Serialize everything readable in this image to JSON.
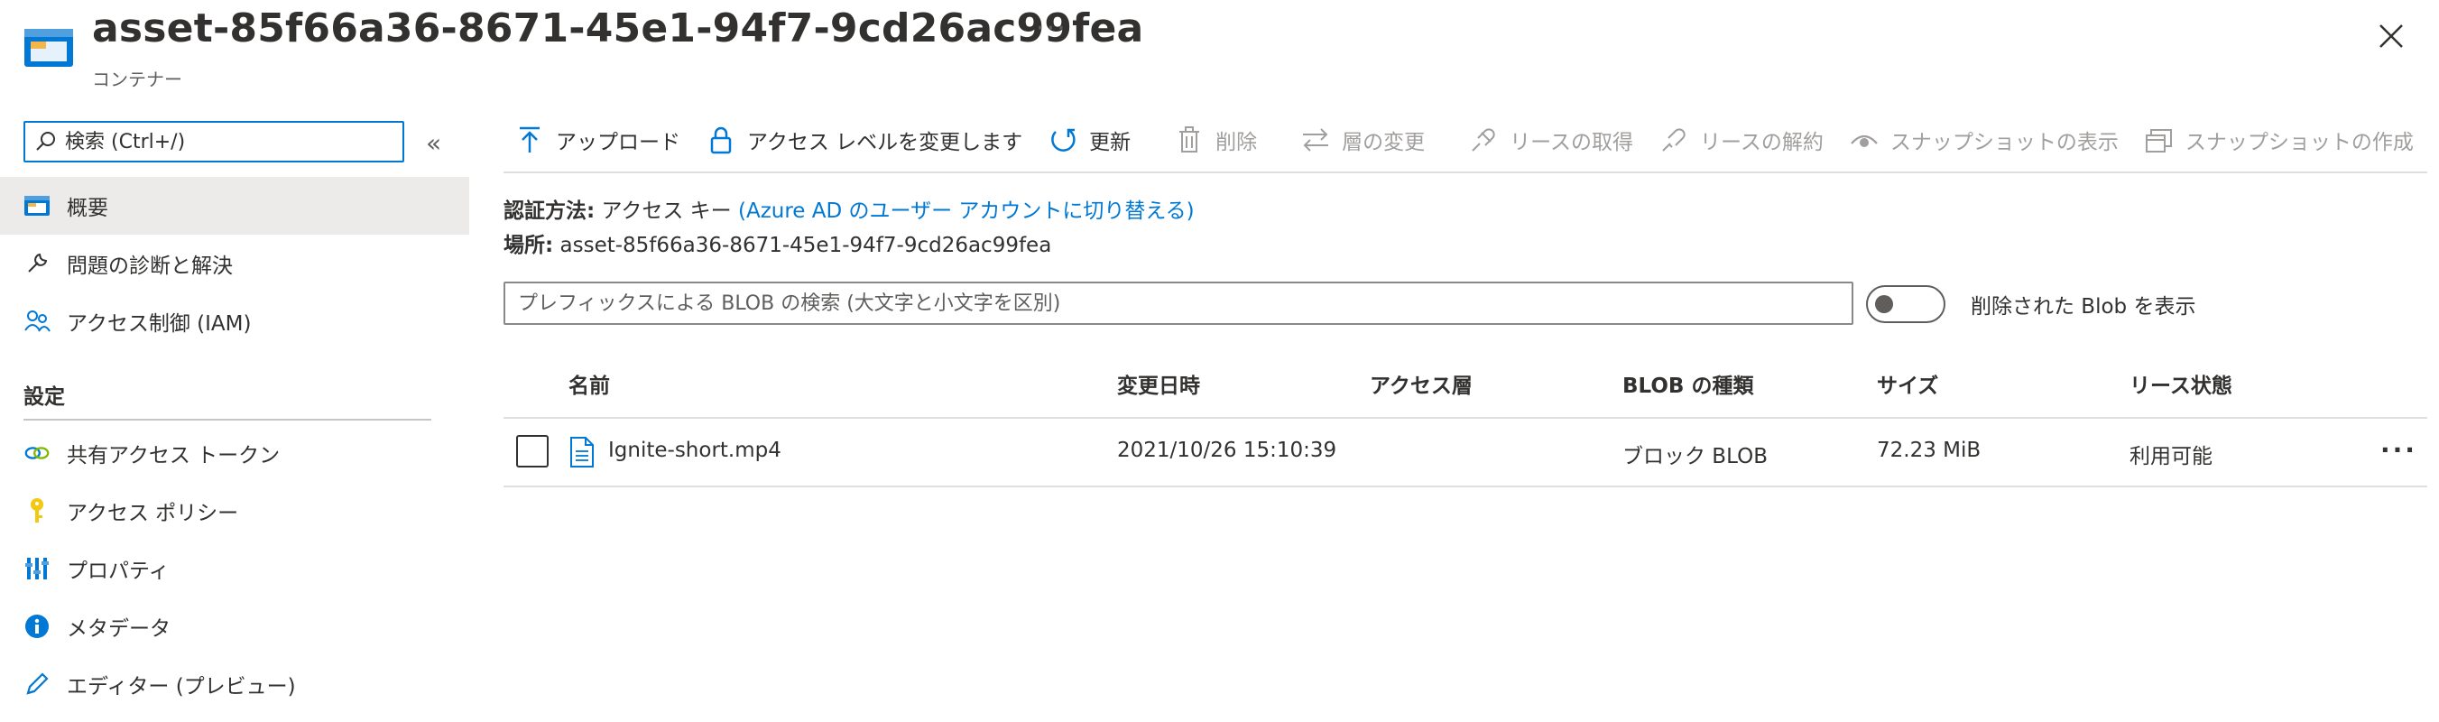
{
  "header": {
    "title": "asset-85f66a36-8671-45e1-94f7-9cd26ac99fea",
    "subtitle": "コンテナー",
    "more_label": "···"
  },
  "sidebar": {
    "search_placeholder": "検索 (Ctrl+/)",
    "collapse_label": "«",
    "items": [
      {
        "label": "概要",
        "icon": "container-icon",
        "selected": true
      },
      {
        "label": "問題の診断と解決",
        "icon": "wrench-icon"
      },
      {
        "label": "アクセス制御 (IAM)",
        "icon": "people-icon"
      }
    ],
    "section_title": "設定",
    "settings_items": [
      {
        "label": "共有アクセス トークン",
        "icon": "link-icon"
      },
      {
        "label": "アクセス ポリシー",
        "icon": "key-icon"
      },
      {
        "label": "プロパティ",
        "icon": "properties-icon"
      },
      {
        "label": "メタデータ",
        "icon": "info-icon"
      },
      {
        "label": "エディター (プレビュー)",
        "icon": "pencil-icon"
      }
    ]
  },
  "toolbar": {
    "upload": "アップロード",
    "change_access": "アクセス レベルを変更します",
    "refresh": "更新",
    "delete": "削除",
    "change_tier": "層の変更",
    "acquire_lease": "リースの取得",
    "break_lease": "リースの解約",
    "view_snapshots": "スナップショットの表示",
    "create_snapshot": "スナップショットの作成"
  },
  "info": {
    "auth_label": "認証方法:",
    "auth_value": "アクセス キー",
    "auth_link": "(Azure AD のユーザー アカウントに切り替える)",
    "location_label": "場所:",
    "location_value": "asset-85f66a36-8671-45e1-94f7-9cd26ac99fea"
  },
  "filter": {
    "placeholder": "プレフィックスによる BLOB の検索 (大文字と小文字を区別)",
    "toggle_label": "削除された Blob を表示",
    "toggle_on": false
  },
  "table": {
    "headers": [
      "名前",
      "変更日時",
      "アクセス層",
      "BLOB の種類",
      "サイズ",
      "リース状態"
    ],
    "rows": [
      {
        "name": "Ignite-short.mp4",
        "modified": "2021/10/26 15:10:39",
        "tier": "",
        "type": "ブロック BLOB",
        "size": "72.23 MiB",
        "lease": "利用可能",
        "more": "···"
      }
    ]
  },
  "colors": {
    "accent": "#0078d4",
    "selected_bg": "#edebe9",
    "disabled": "#a19f9d"
  }
}
